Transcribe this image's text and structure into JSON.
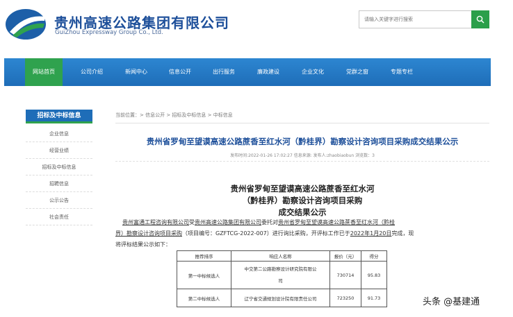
{
  "header": {
    "brand_cn": "贵州高速公路集团有限公司",
    "brand_en": "GuiZhou Expressway Group Co., Ltd.",
    "search_placeholder": "请输入关键字进行搜索",
    "accent_blue": "#1e6db8",
    "accent_green": "#2fa24e"
  },
  "nav": {
    "items": [
      "网站首页",
      "公司介绍",
      "新闻中心",
      "信息公开",
      "出行服务",
      "廉政建设",
      "企业文化",
      "党群之窗",
      "专题专栏"
    ],
    "active_index": 0
  },
  "sidebar": {
    "title": "招标及中标信息",
    "items": [
      "企业信息",
      "经营业绩",
      "招标及中标信息",
      "招聘信息",
      "公示公告",
      "社会责任"
    ]
  },
  "breadcrumb": "当前位置：> 信息公开 > 招标及中标信息 > 中标信息",
  "article": {
    "title": "贵州省罗甸至望谟高速公路蔗香至红水河（黔桂界）勘察设计咨询项目采购成交结果公示",
    "meta": "发布时间:2022-01-26 17:02:27    信息来源:    发布人:zhaobiaobun    浏览数：3",
    "doc_title_lines": [
      "贵州省罗甸至望谟高速公路蔗香至红水河",
      "（黔桂界）勘察设计咨询项目采购",
      "成交结果公示"
    ],
    "para": {
      "l1_a": "贵州富通工程咨询有限公司",
      "l1_b": "受",
      "l1_c": "贵州高速公路集团有限公司",
      "l1_d": "委托对",
      "l1_e": "贵州省罗甸至望谟高速公路蔗香至红水河（黔桂",
      "l2_a": "界）勘察设计咨询项目采购",
      "l2_b": "（项目编号：GZFTCG-2022-007）进行询比采购，开评标工作已于",
      "l2_c": "2022年1月20日",
      "l2_d": "完成，现",
      "l3": "将评标结果公示如下："
    },
    "table": {
      "headers": [
        "推荐排序",
        "响应人名称",
        "报价（元）",
        "得分"
      ],
      "rows": [
        {
          "rank": "第一中标候选人",
          "name_l1": "中交第二公路勘察设计研究院有限公",
          "name_l2": "司",
          "price": "730714",
          "score": "95.83"
        },
        {
          "rank": "第二中标候选人",
          "name_l1": "辽宁省交通规划设计院有限责任公司",
          "name_l2": "",
          "price": "723250",
          "score": "91.73"
        }
      ]
    }
  },
  "watermark": "头条 @基建通"
}
